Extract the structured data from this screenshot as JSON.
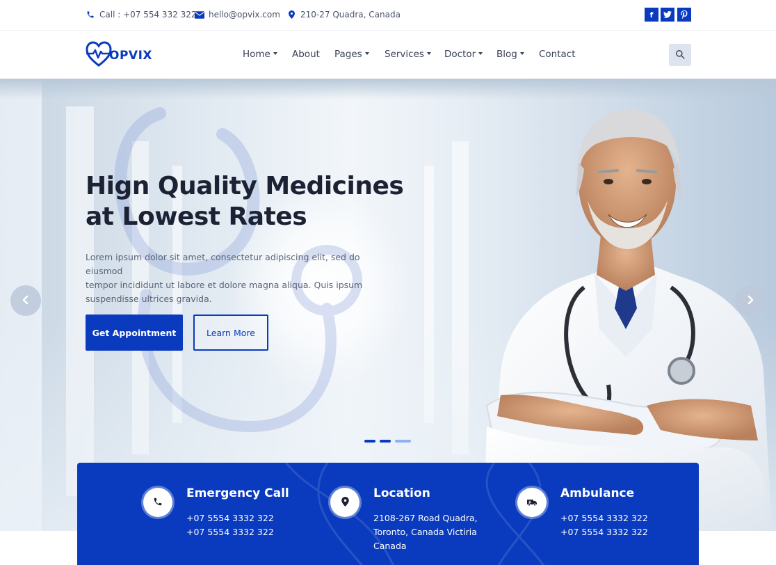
{
  "topbar": {
    "phone": "Call : +07 554 332 322",
    "email": "hello@opvix.com",
    "address": "210-27 Quadra, Canada",
    "social": [
      {
        "icon": "facebook-icon",
        "glyph": "f"
      },
      {
        "icon": "twitter-icon",
        "glyph": "t"
      },
      {
        "icon": "pinterest-icon",
        "glyph": "p"
      }
    ]
  },
  "nav": {
    "logo_text": "OPVIX",
    "items": [
      {
        "label": "Home",
        "dropdown": true
      },
      {
        "label": "About",
        "dropdown": false
      },
      {
        "label": "Pages",
        "dropdown": true
      },
      {
        "label": "Services",
        "dropdown": true
      },
      {
        "label": "Doctor",
        "dropdown": true
      },
      {
        "label": "Blog",
        "dropdown": true
      },
      {
        "label": "Contact",
        "dropdown": false
      }
    ]
  },
  "hero": {
    "title_line1": "Hign Quality Medicines",
    "title_line2": "at Lowest Rates",
    "lead_line1": "Lorem ipsum dolor sit amet, consectetur adipiscing elit, sed do eiusmod",
    "lead_line2": "tempor incididunt ut labore et dolore magna aliqua. Quis ipsum",
    "lead_line3": "suspendisse ultrices gravida.",
    "primary_button": "Get Appointment",
    "secondary_button": "Learn More",
    "slides": 3,
    "active_slide": 1
  },
  "features": [
    {
      "icon": "phone-icon",
      "title": "Emergency Call",
      "lines": [
        "+07 5554 3332 322",
        "+07 5554 3332 322"
      ]
    },
    {
      "icon": "location-pin-icon",
      "title": "Location",
      "lines": [
        "2108-267 Road Quadra,",
        "Toronto, Canada Victiria",
        "Canada"
      ]
    },
    {
      "icon": "ambulance-icon",
      "title": "Ambulance",
      "lines": [
        "+07 5554 3332 322",
        "+07 5554 3332 322"
      ]
    }
  ],
  "colors": {
    "brand": "#0a3bbf",
    "text_dark": "#1c2233",
    "text_muted": "#5a6478"
  }
}
